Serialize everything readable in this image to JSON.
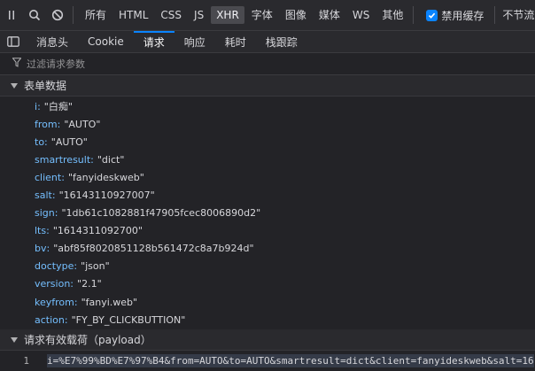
{
  "toolbar": {
    "filters": [
      "所有",
      "HTML",
      "CSS",
      "JS",
      "XHR",
      "字体",
      "图像",
      "媒体",
      "WS",
      "其他"
    ],
    "active_filter": "XHR",
    "disable_cache_label": "禁用缓存",
    "disable_cache_checked": true,
    "throttle_label": "不节流"
  },
  "tabs": {
    "items": [
      "消息头",
      "Cookie",
      "请求",
      "响应",
      "耗时",
      "栈跟踪"
    ],
    "active": "请求"
  },
  "filter": {
    "placeholder": "过滤请求参数"
  },
  "form_section": {
    "title": "表单数据",
    "rows": [
      {
        "key": "i",
        "value": "\"白痴\""
      },
      {
        "key": "from",
        "value": "\"AUTO\""
      },
      {
        "key": "to",
        "value": "\"AUTO\""
      },
      {
        "key": "smartresult",
        "value": "\"dict\""
      },
      {
        "key": "client",
        "value": "\"fanyideskweb\""
      },
      {
        "key": "salt",
        "value": "\"16143110927007\""
      },
      {
        "key": "sign",
        "value": "\"1db61c1082881f47905fcec8006890d2\""
      },
      {
        "key": "lts",
        "value": "\"1614311092700\""
      },
      {
        "key": "bv",
        "value": "\"abf85f8020851128b561472c8a7b924d\""
      },
      {
        "key": "doctype",
        "value": "\"json\""
      },
      {
        "key": "version",
        "value": "\"2.1\""
      },
      {
        "key": "keyfrom",
        "value": "\"fanyi.web\""
      },
      {
        "key": "action",
        "value": "\"FY_BY_CLICKBUTTION\""
      }
    ]
  },
  "payload_section": {
    "title": "请求有效载荷（payload）",
    "line_number": "1",
    "line_text": "i=%E7%99%BD%E7%97%B4&from=AUTO&to=AUTO&smartresult=dict&client=fanyideskweb&salt=16"
  },
  "colors": {
    "background": "#232327",
    "toolbar": "#2a2a2e",
    "accent": "#0a84ff",
    "key": "#75bfff",
    "text": "#d7d7db"
  }
}
